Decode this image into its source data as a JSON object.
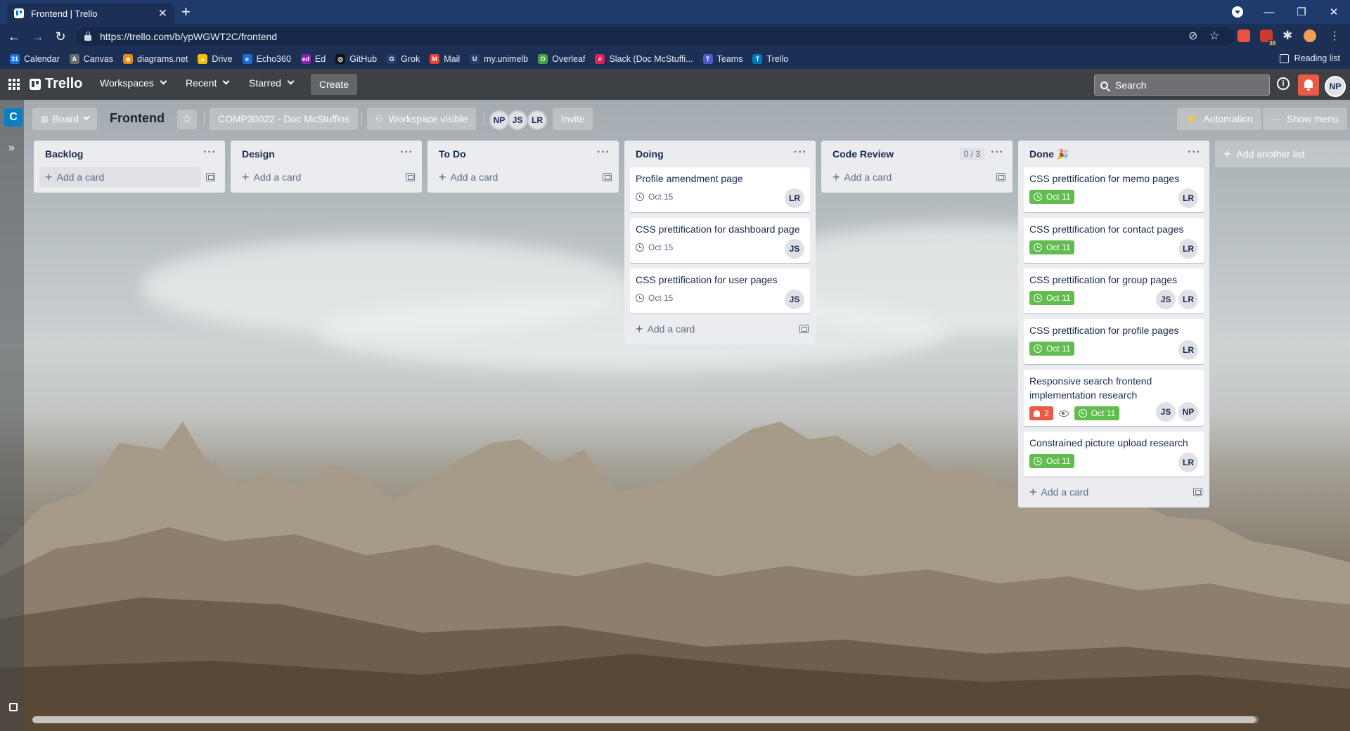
{
  "browser": {
    "tab_title": "Frontend | Trello",
    "url": "https://trello.com/b/ypWGWT2C/frontend",
    "new_tab_label": "+",
    "extension_badge": "38",
    "bookmarks": [
      {
        "label": "Calendar",
        "color": "#1a73e8",
        "glyph": "31"
      },
      {
        "label": "Canvas",
        "color": "#6b6b6b",
        "glyph": "A"
      },
      {
        "label": "diagrams.net",
        "color": "#f08705",
        "glyph": "◆"
      },
      {
        "label": "Drive",
        "color": "#fbbc04",
        "glyph": "▲"
      },
      {
        "label": "Echo360",
        "color": "#1e6bd6",
        "glyph": "e"
      },
      {
        "label": "Ed",
        "color": "#8b1fb8",
        "glyph": "ed"
      },
      {
        "label": "GitHub",
        "color": "#111111",
        "glyph": "◎"
      },
      {
        "label": "Grok",
        "color": "#2b3e6b",
        "glyph": "G"
      },
      {
        "label": "Mail",
        "color": "#ea4335",
        "glyph": "M"
      },
      {
        "label": "my.unimelb",
        "color": "#2b3e6b",
        "glyph": "U"
      },
      {
        "label": "Overleaf",
        "color": "#47a141",
        "glyph": "O"
      },
      {
        "label": "Slack (Doc McStuffi...",
        "color": "#e01e5a",
        "glyph": "#"
      },
      {
        "label": "Teams",
        "color": "#5059c9",
        "glyph": "T"
      },
      {
        "label": "Trello",
        "color": "#0079bf",
        "glyph": "T"
      }
    ],
    "reading_list": "Reading list"
  },
  "header": {
    "logo": "Trello",
    "menus": [
      "Workspaces",
      "Recent",
      "Starred"
    ],
    "create": "Create",
    "search_placeholder": "Search",
    "user_initials": "NP"
  },
  "sidebar": {
    "workspace_initial": "C",
    "expand_icon": "»"
  },
  "board": {
    "view": "Board",
    "title": "Frontend",
    "workspace": "COMP30022 - Doc McStuffins",
    "visibility": "Workspace visible",
    "members": [
      "NP",
      "JS",
      "LR"
    ],
    "invite": "Invite",
    "automation": "Automation",
    "show_menu": "Show menu",
    "add_list": "Add another list",
    "add_card": "Add a card",
    "lists": [
      {
        "title": "Backlog",
        "cards": []
      },
      {
        "title": "Design",
        "cards": []
      },
      {
        "title": "To Do",
        "cards": []
      },
      {
        "title": "Doing",
        "cards": [
          {
            "title": "Profile amendment page",
            "due": "Oct 15",
            "members": [
              "LR"
            ]
          },
          {
            "title": "CSS prettification for dashboard page",
            "due": "Oct 15",
            "members": [
              "JS"
            ]
          },
          {
            "title": "CSS prettification for user pages",
            "due": "Oct 15",
            "members": [
              "JS"
            ]
          }
        ]
      },
      {
        "title": "Code Review",
        "limit": "0 / 3",
        "cards": []
      },
      {
        "title": "Done 🎉",
        "cards": [
          {
            "title": "CSS prettification for memo pages",
            "due": "Oct 11",
            "members": [
              "LR"
            ]
          },
          {
            "title": "CSS prettification for contact pages",
            "due": "Oct 11",
            "members": [
              "LR"
            ]
          },
          {
            "title": "CSS prettification for group pages",
            "due": "Oct 11",
            "members": [
              "JS",
              "LR"
            ]
          },
          {
            "title": "CSS prettification for profile pages",
            "due": "Oct 11",
            "members": [
              "LR"
            ]
          },
          {
            "title": "Responsive search frontend implementation research",
            "notifications": "2",
            "watching": true,
            "due": "Oct 11",
            "members": [
              "JS",
              "NP"
            ]
          },
          {
            "title": "Constrained picture upload research",
            "due": "Oct 11",
            "members": [
              "LR"
            ]
          }
        ]
      }
    ]
  },
  "colors": {
    "due_complete": "#61bd4f",
    "notification": "#eb5a46",
    "workspace_badge": "#0a7ec4"
  }
}
